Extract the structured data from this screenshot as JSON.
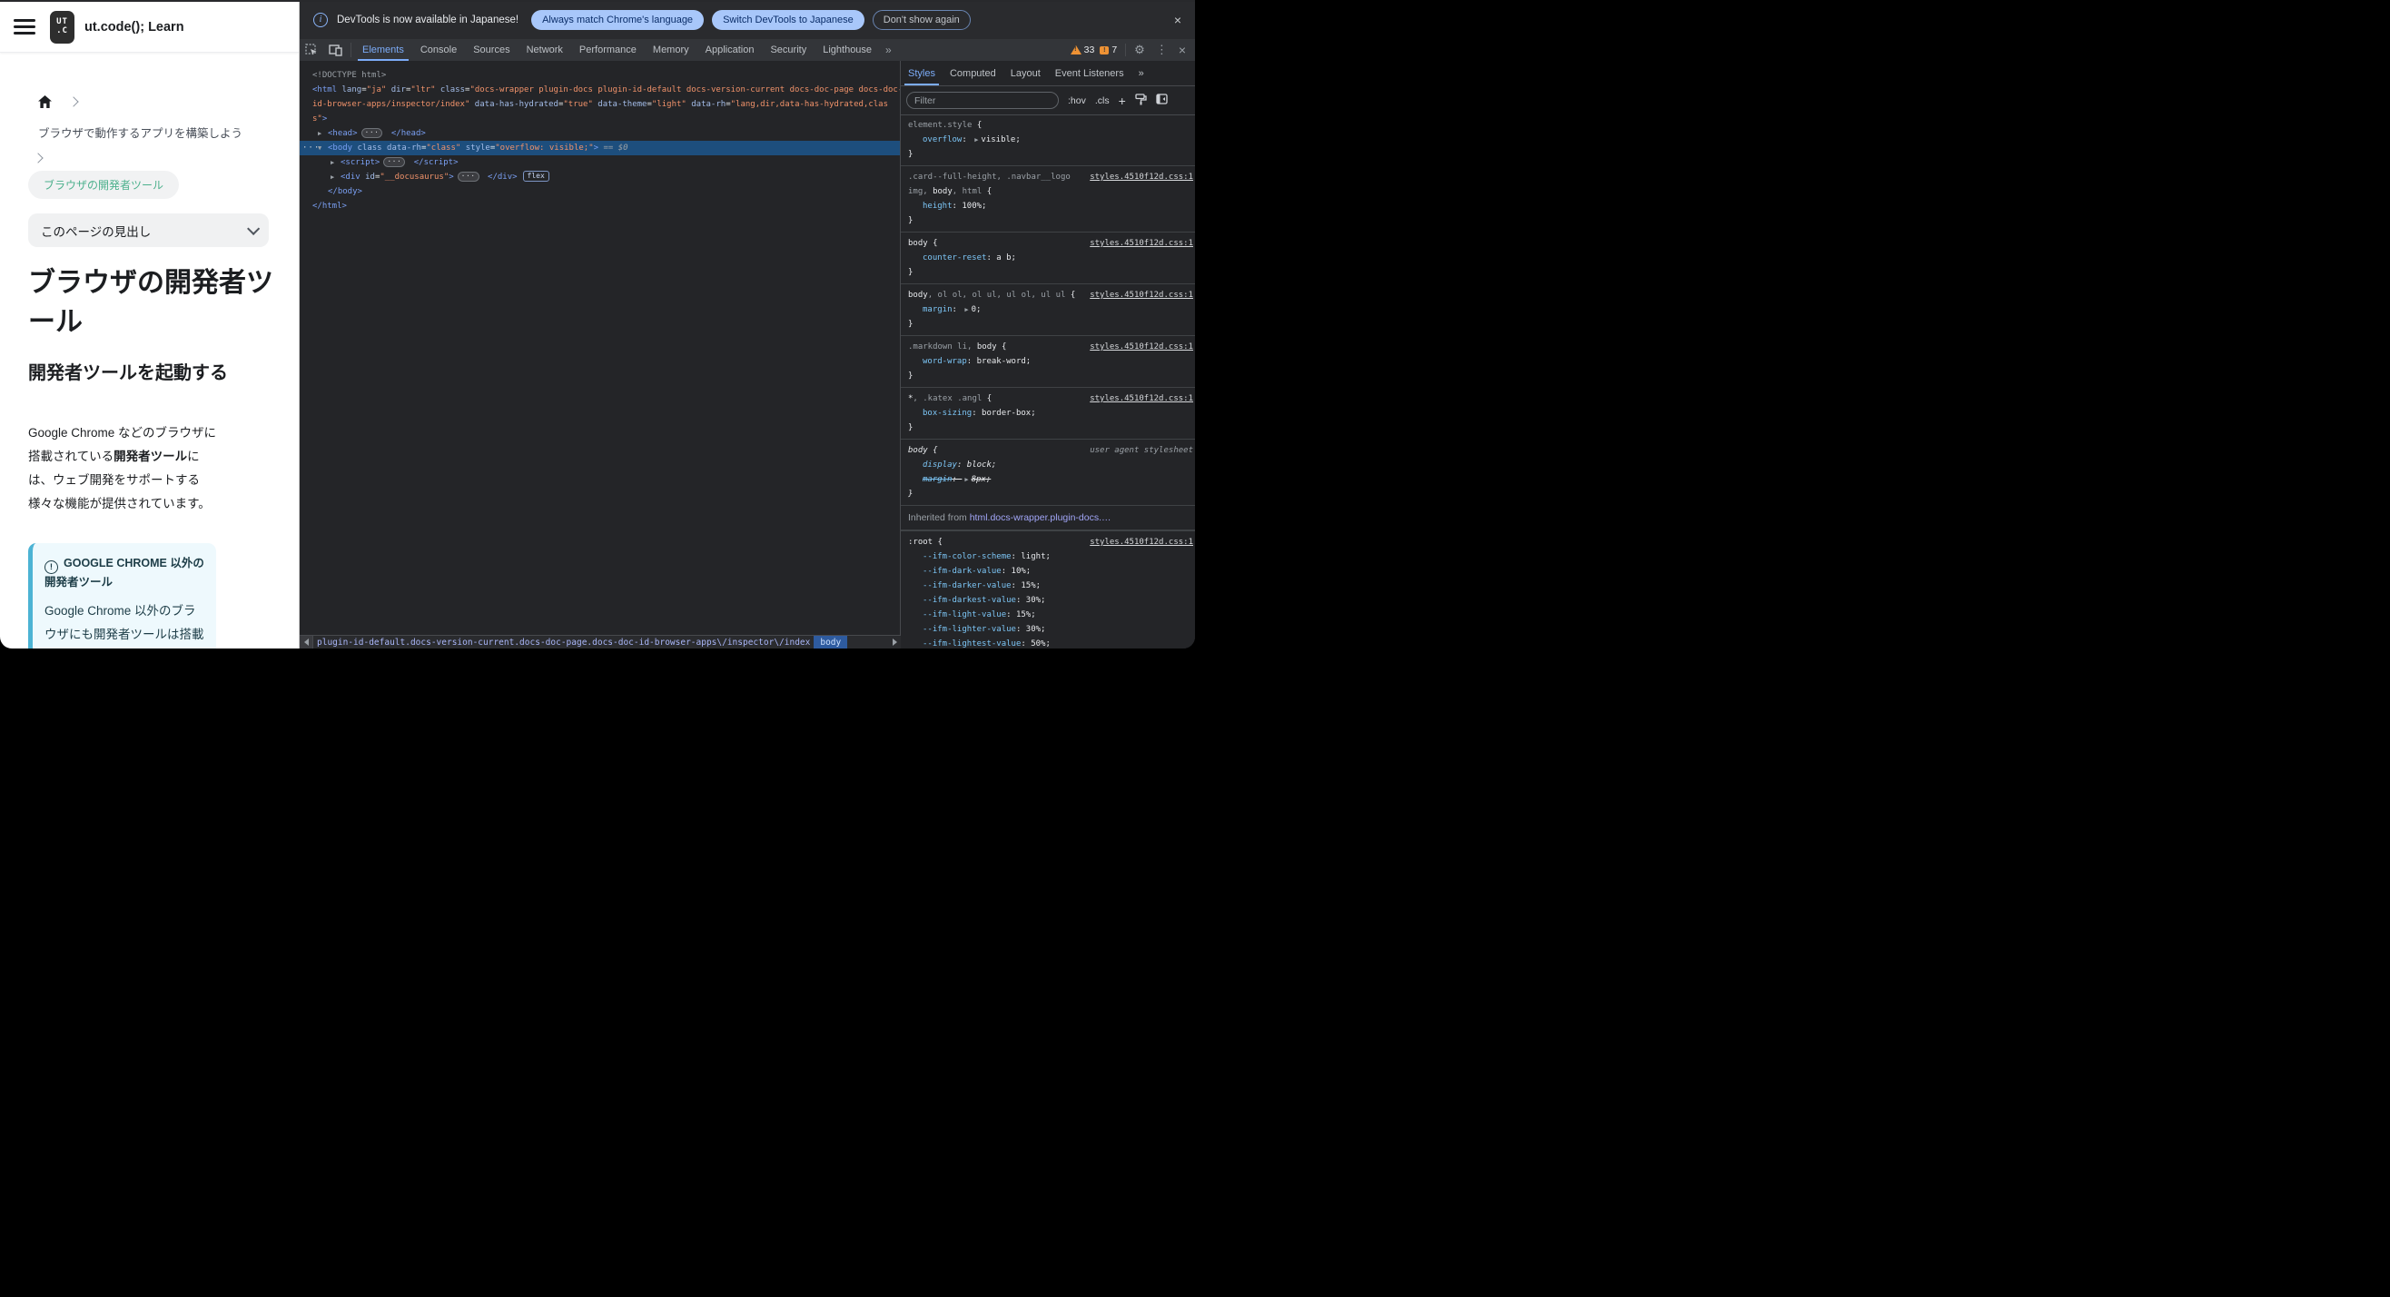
{
  "page": {
    "navbar": {
      "title": "ut.code(); Learn",
      "logo_line1": "UT",
      "logo_line2": ".C"
    },
    "breadcrumbs": {
      "level1": "ブラウザで動作するアプリを構築しよう",
      "current": "ブラウザの開発者ツール"
    },
    "toc_label": "このページの見出し",
    "h1": "ブラウザの開発者ツール",
    "h2": "開発者ツールを起動する",
    "paragraph": {
      "pre": "Google Chrome などのブラウザに搭載されている",
      "bold": "開発者ツール",
      "post": "には、ウェブ開発をサポートする様々な機能が提供されています。"
    },
    "admonition": {
      "title": "GOOGLE CHROME 以外の開発者ツール",
      "body": "Google Chrome 以外のブラウザにも開発者ツールは搭載されて"
    }
  },
  "devtools": {
    "notification": {
      "text": "DevTools is now available in Japanese!",
      "actions": [
        "Always match Chrome's language",
        "Switch DevTools to Japanese"
      ],
      "dismiss": "Don't show again"
    },
    "tabs": [
      "Elements",
      "Console",
      "Sources",
      "Network",
      "Performance",
      "Memory",
      "Application",
      "Security",
      "Lighthouse"
    ],
    "active_tab": "Elements",
    "more_tabs_glyph": "»",
    "warnings_count": "33",
    "issues_count": "7",
    "elements_tree": {
      "lines": [
        {
          "ind": 0,
          "tokens": [
            {
              "c": "g",
              "t": "<!DOCTYPE html>"
            }
          ]
        },
        {
          "ind": 0,
          "tokens": [
            {
              "c": "t",
              "t": "<html"
            },
            {
              "c": "a",
              "t": " lang"
            },
            {
              "c": "p",
              "t": "="
            },
            {
              "c": "v",
              "t": "\"ja\""
            },
            {
              "c": "a",
              "t": " dir"
            },
            {
              "c": "p",
              "t": "="
            },
            {
              "c": "v",
              "t": "\"ltr\""
            },
            {
              "c": "a",
              "t": " class"
            },
            {
              "c": "p",
              "t": "="
            },
            {
              "c": "v",
              "t": "\"docs-wrapper plugin-docs plugin-id-default docs-version-current docs-doc-page docs-doc-"
            }
          ]
        },
        {
          "ind": 0,
          "tokens": [
            {
              "c": "v",
              "t": "id-browser-apps/inspector/index\""
            },
            {
              "c": "a",
              "t": " data-has-hydrated"
            },
            {
              "c": "p",
              "t": "="
            },
            {
              "c": "v",
              "t": "\"true\""
            },
            {
              "c": "a",
              "t": " data-theme"
            },
            {
              "c": "p",
              "t": "="
            },
            {
              "c": "v",
              "t": "\"light\""
            },
            {
              "c": "a",
              "t": " data-rh"
            },
            {
              "c": "p",
              "t": "="
            },
            {
              "c": "v",
              "t": "\"lang,dir,data-has-hydrated,clas"
            }
          ]
        },
        {
          "ind": 0,
          "tokens": [
            {
              "c": "v",
              "t": "s\""
            },
            {
              "c": "t",
              "t": ">"
            }
          ]
        },
        {
          "ind": 1,
          "arrow": "▶",
          "tokens": [
            {
              "c": "t",
              "t": "<head>"
            },
            {
              "c": "dots",
              "t": "···"
            },
            {
              "c": "t",
              "t": " </head>"
            }
          ]
        },
        {
          "ind": 1,
          "arrow": "▼",
          "selected": true,
          "gutter": "···",
          "tokens": [
            {
              "c": "t",
              "t": "<body"
            },
            {
              "c": "a",
              "t": " class data-rh"
            },
            {
              "c": "p",
              "t": "="
            },
            {
              "c": "v",
              "t": "\"class\""
            },
            {
              "c": "a",
              "t": " style"
            },
            {
              "c": "p",
              "t": "="
            },
            {
              "c": "v",
              "t": "\"overflow: visible;\""
            },
            {
              "c": "t",
              "t": ">"
            },
            {
              "c": "eq",
              "t": " == $0"
            }
          ]
        },
        {
          "ind": 2,
          "arrow": "▶",
          "tokens": [
            {
              "c": "t",
              "t": "<script>"
            },
            {
              "c": "dots",
              "t": "···"
            },
            {
              "c": "t",
              "t": " </script>"
            }
          ]
        },
        {
          "ind": 2,
          "arrow": "▶",
          "tokens": [
            {
              "c": "t",
              "t": "<div"
            },
            {
              "c": "a",
              "t": " id"
            },
            {
              "c": "p",
              "t": "="
            },
            {
              "c": "v",
              "t": "\"__docusaurus\""
            },
            {
              "c": "t",
              "t": ">"
            },
            {
              "c": "dots",
              "t": "···"
            },
            {
              "c": "t",
              "t": " </div>"
            },
            {
              "c": "badge",
              "t": "flex"
            }
          ]
        },
        {
          "ind": 1,
          "noarrow": true,
          "tokens": [
            {
              "c": "t",
              "t": "</body>"
            }
          ]
        },
        {
          "ind": 0,
          "tokens": [
            {
              "c": "t",
              "t": "</html>"
            }
          ]
        }
      ]
    },
    "sidebar": {
      "tabs": [
        "Styles",
        "Computed",
        "Layout",
        "Event Listeners"
      ],
      "active": "Styles",
      "more_tabs_glyph": "»",
      "filter_placeholder": "Filter",
      "pseudo_toggle": ":hov",
      "class_toggle": ".cls",
      "plus_glyph": "+"
    },
    "styles": {
      "sections": [
        {
          "sel": [
            {
              "c": "g",
              "t": "element.style"
            }
          ],
          "link": "",
          "decls": [
            {
              "p": "overflow",
              "arrow": true,
              "v": "visible"
            }
          ]
        },
        {
          "sel": [
            {
              "c": "g",
              "t": ".card--full-height, .navbar__logo"
            },
            {
              "c": "br",
              "t": ""
            },
            {
              "c": "g",
              "t": "img, "
            },
            {
              "c": "w",
              "t": "body"
            },
            {
              "c": "g",
              "t": ", html"
            }
          ],
          "link": "styles.4510f12d.css:1",
          "decls": [
            {
              "p": "height",
              "v": "100%"
            }
          ]
        },
        {
          "sel": [
            {
              "c": "w",
              "t": "body"
            }
          ],
          "link": "styles.4510f12d.css:1",
          "decls": [
            {
              "p": "counter-reset",
              "v": "a b"
            }
          ]
        },
        {
          "sel": [
            {
              "c": "w",
              "t": "body"
            },
            {
              "c": "g",
              "t": ", ol ol, ol ul, ul ol, ul ul"
            }
          ],
          "link": "styles.4510f12d.css:1",
          "decls": [
            {
              "p": "margin",
              "arrow": true,
              "v": "0"
            }
          ]
        },
        {
          "sel": [
            {
              "c": "g",
              "t": ".markdown li, "
            },
            {
              "c": "w",
              "t": "body"
            }
          ],
          "link": "styles.4510f12d.css:1",
          "decls": [
            {
              "p": "word-wrap",
              "v": "break-word"
            }
          ]
        },
        {
          "sel": [
            {
              "c": "w",
              "t": "*"
            },
            {
              "c": "g",
              "t": ", .katex .angl"
            }
          ],
          "link": "styles.4510f12d.css:1",
          "decls": [
            {
              "p": "box-sizing",
              "v": "border-box"
            }
          ]
        },
        {
          "italic": true,
          "sel": [
            {
              "c": "w",
              "t": "body"
            }
          ],
          "link": "user agent stylesheet",
          "ua": true,
          "decls": [
            {
              "p": "display",
              "v": "block"
            },
            {
              "p": "margin",
              "arrow": true,
              "v": "8px",
              "struck": true
            }
          ]
        },
        {
          "header": true,
          "label": "Inherited from ",
          "hlink": "html.docs-wrapper.plugin-docs.…"
        },
        {
          "sel": [
            {
              "c": "w",
              "t": ":root"
            }
          ],
          "link": "styles.4510f12d.css:1",
          "decls": [
            {
              "p": "--ifm-color-scheme",
              "v": "light"
            },
            {
              "p": "--ifm-dark-value",
              "v": "10%"
            },
            {
              "p": "--ifm-darker-value",
              "v": "15%"
            },
            {
              "p": "--ifm-darkest-value",
              "v": "30%"
            },
            {
              "p": "--ifm-light-value",
              "v": "15%"
            },
            {
              "p": "--ifm-lighter-value",
              "v": "30%"
            },
            {
              "p": "--ifm-lightest-value",
              "v": "50%"
            }
          ]
        }
      ]
    },
    "crumbs": {
      "path": "plugin-id-default.docs-version-current.docs-doc-page.docs-doc-id-browser-apps\\/inspector\\/index",
      "selected": "body"
    }
  },
  "colors": {
    "accent_blue": "#7cacf8",
    "selection_blue": "#1d4e7d",
    "tag_blue": "#7a9ff2",
    "value_orange": "#f0926a",
    "warning_orange": "#ee9234",
    "pill_blue": "#a8c7fa",
    "page_green": "#4cb08c",
    "admonition_blue": "#4cb3d4"
  }
}
